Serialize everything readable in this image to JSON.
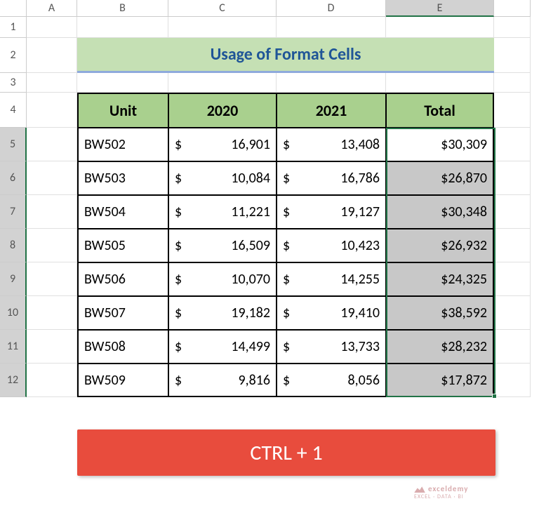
{
  "columns": {
    "A": {
      "label": "A",
      "width_class": "cA"
    },
    "B": {
      "label": "B",
      "width_class": "cB"
    },
    "C": {
      "label": "C",
      "width_class": "cC"
    },
    "D": {
      "label": "D",
      "width_class": "cD"
    },
    "E": {
      "label": "E",
      "width_class": "cE",
      "selected": true
    },
    "F": {
      "label": "",
      "width_class": "cF"
    }
  },
  "row_numbers": [
    "1",
    "2",
    "3",
    "4",
    "5",
    "6",
    "7",
    "8",
    "9",
    "10",
    "11",
    "12"
  ],
  "selected_rows": [
    "5",
    "6",
    "7",
    "8",
    "9",
    "10",
    "11",
    "12"
  ],
  "title": "Usage of Format Cells",
  "headers": {
    "unit": "Unit",
    "y2020": "2020",
    "y2021": "2021",
    "total": "Total"
  },
  "currency_symbol": "$",
  "rows": [
    {
      "unit": "BW502",
      "y2020": "16,901",
      "y2021": "13,408",
      "total": "$30,309"
    },
    {
      "unit": "BW503",
      "y2020": "10,084",
      "y2021": "16,786",
      "total": "$26,870"
    },
    {
      "unit": "BW504",
      "y2020": "11,221",
      "y2021": "19,127",
      "total": "$30,348"
    },
    {
      "unit": "BW505",
      "y2020": "16,509",
      "y2021": "10,423",
      "total": "$26,932"
    },
    {
      "unit": "BW506",
      "y2020": "10,070",
      "y2021": "14,255",
      "total": "$24,325"
    },
    {
      "unit": "BW507",
      "y2020": "19,182",
      "y2021": "19,410",
      "total": "$38,592"
    },
    {
      "unit": "BW508",
      "y2020": "14,499",
      "y2021": "13,733",
      "total": "$28,232"
    },
    {
      "unit": "BW509",
      "y2020": "9,816",
      "y2021": "8,056",
      "total": "$17,872"
    }
  ],
  "shortcut": "CTRL + 1",
  "watermark": {
    "line1": "exceldemy",
    "line2": "EXCEL · DATA · BI"
  },
  "selection": {
    "col": "E",
    "row_start": 5,
    "row_end": 12
  }
}
